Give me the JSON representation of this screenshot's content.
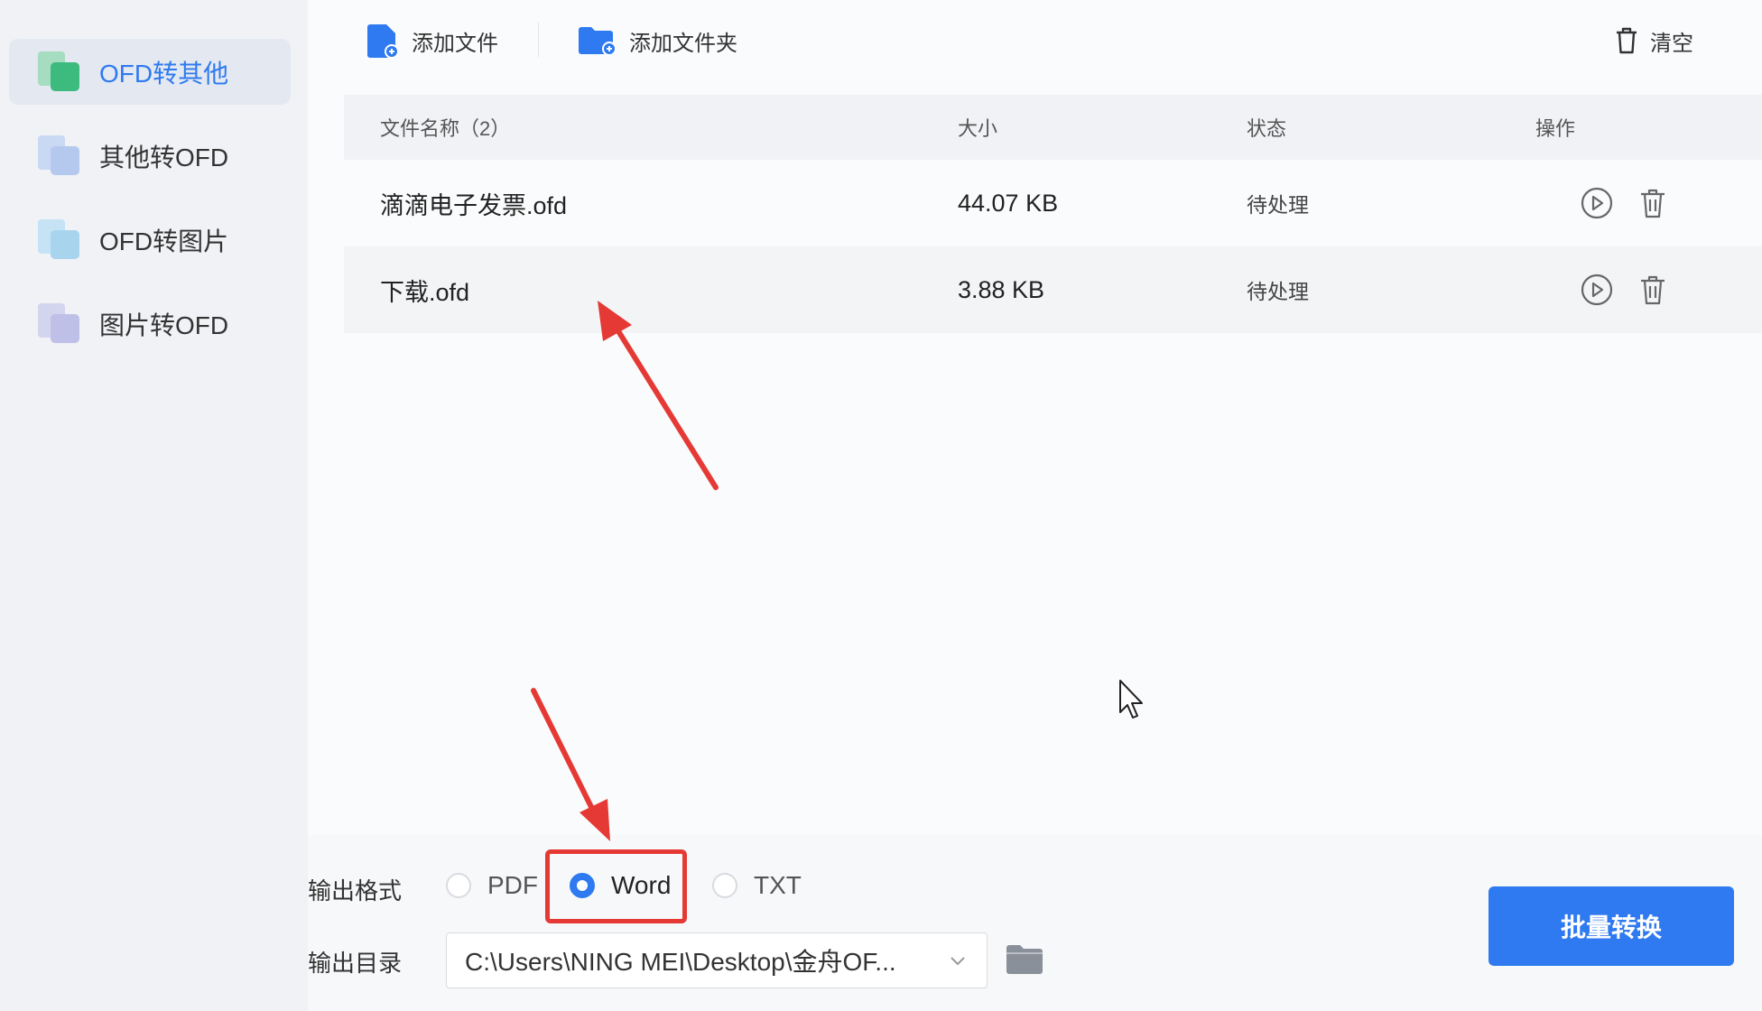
{
  "sidebar": {
    "items": [
      {
        "label": "OFD转其他",
        "icon": "ofd-to-other-icon",
        "active": true
      },
      {
        "label": "其他转OFD",
        "icon": "other-to-ofd-icon",
        "active": false
      },
      {
        "label": "OFD转图片",
        "icon": "ofd-to-image-icon",
        "active": false
      },
      {
        "label": "图片转OFD",
        "icon": "image-to-ofd-icon",
        "active": false
      }
    ]
  },
  "toolbar": {
    "add_file_label": "添加文件",
    "add_folder_label": "添加文件夹",
    "clear_label": "清空"
  },
  "table": {
    "headers": {
      "name": "文件名称（2）",
      "size": "大小",
      "status": "状态",
      "actions": "操作"
    },
    "rows": [
      {
        "name": "滴滴电子发票.ofd",
        "size": "44.07 KB",
        "status": "待处理"
      },
      {
        "name": "下载.ofd",
        "size": "3.88 KB",
        "status": "待处理"
      }
    ]
  },
  "output": {
    "format_label": "输出格式",
    "formats": [
      "PDF",
      "Word",
      "TXT"
    ],
    "selected_format": "Word",
    "dir_label": "输出目录",
    "dir_value": "C:\\Users\\NING MEI\\Desktop\\金舟OF..."
  },
  "convert_button_label": "批量转换",
  "colors": {
    "accent": "#2f7af0",
    "annotation": "#e53935"
  }
}
